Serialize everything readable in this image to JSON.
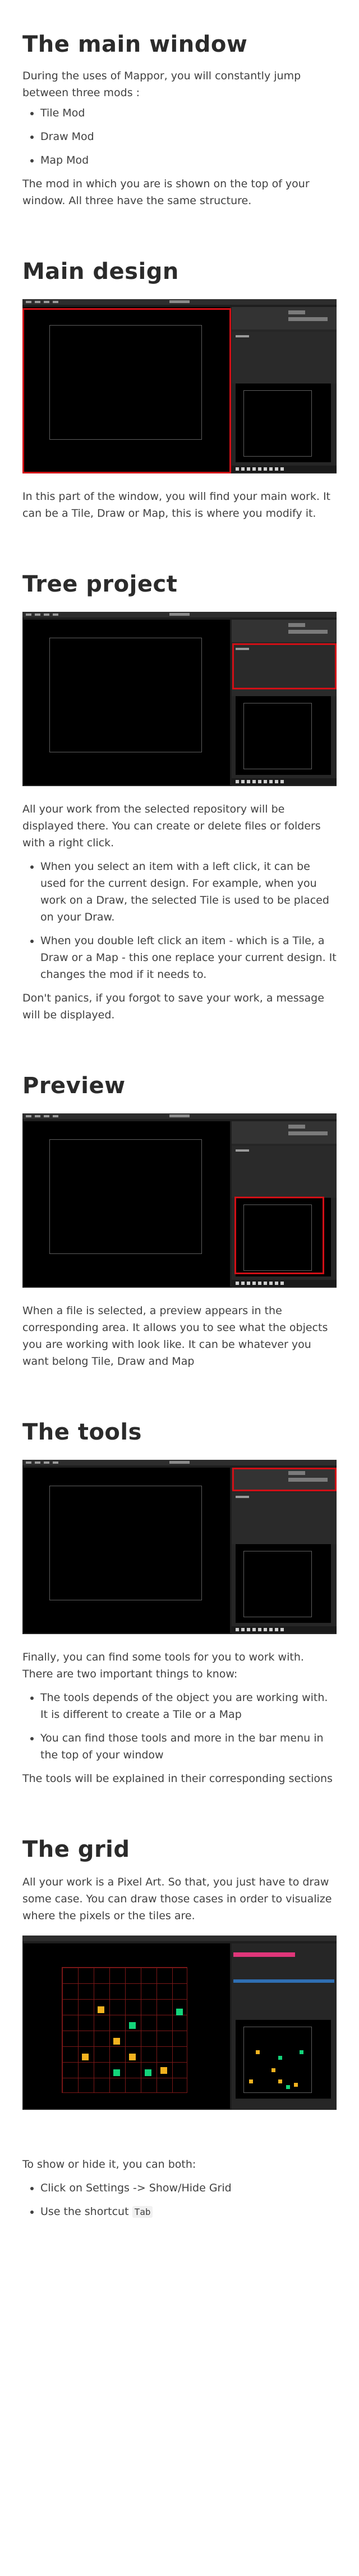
{
  "title": "The main window",
  "intro": "During the uses of Mappor, you will constantly jump between three mods :",
  "mods": [
    "Tile Mod",
    "Draw Mod",
    "Map Mod"
  ],
  "mods_note": "The mod in which you are is shown on the top of your window. All three have the same structure.",
  "sections": {
    "main_design": {
      "heading": "Main design",
      "text": "In this part of the window, you will find your main work. It can be a Tile, Draw or Map, this is where you modify it."
    },
    "tree_project": {
      "heading": "Tree project",
      "text": "All your work from the selected repository will be displayed there. You can create or delete files or folders with a right click.",
      "bullets": [
        "When you select an item with a left click, it can be used for the current design. For example, when you work on a Draw, the selected Tile is used to be placed on your Draw.",
        "When you double left click an item - which is a Tile, a Draw or a Map - this one replace your current design. It changes the mod if it needs to."
      ],
      "note": "Don't panics, if you forgot to save your work, a message will be displayed."
    },
    "preview": {
      "heading": "Preview",
      "text": "When a file is selected, a preview appears in the corresponding area. It allows you to see what the objects you are working with look like. It can be whatever you want belong Tile, Draw and Map"
    },
    "tools": {
      "heading": "The tools",
      "text": "Finally, you can find some tools for you to work with. There are two important things to know:",
      "bullets": [
        "The tools depends of the object you are working with. It is different to create a Tile or a Map",
        "You can find those tools and more in the bar menu in the top of your window"
      ],
      "note": "The tools will be explained in their corresponding sections"
    },
    "grid": {
      "heading": "The grid",
      "text": "All your work is a Pixel Art. So that, you just have to draw some case. You can draw those cases in order to visualize where the pixels or the tiles are.",
      "show_hide": "To show or hide it, you can both:",
      "bullet1": "Click on Settings -> Show/Hide Grid",
      "bullet2_prefix": "Use the shortcut ",
      "bullet2_key": "Tab"
    }
  },
  "colors": {
    "highlight": "#d10f16",
    "pixel_yellow": "#f2b21f",
    "pixel_green": "#13d47a"
  }
}
